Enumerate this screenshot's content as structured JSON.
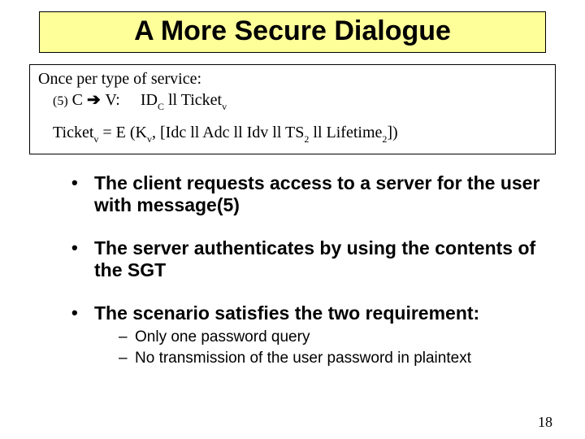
{
  "title": "A More Secure Dialogue",
  "protocol": {
    "intro": "Once per type of service:",
    "step": "(5)",
    "from": "C",
    "to": "V:",
    "payload_pre": "ID",
    "payload_sub": "C",
    "payload_post": " ll Ticket",
    "payload_sub2": "v",
    "ticket_lhs": "Ticket",
    "ticket_sub": "v",
    "ticket_eq": " = E (K",
    "ticket_k_sub": "v",
    "ticket_mid": ", [Idc ll Adc ll Idv ll TS",
    "ticket_ts_sub": "2",
    "ticket_mid2": " ll Lifetime",
    "ticket_lt_sub": "2",
    "ticket_end": "])"
  },
  "bullets": [
    "The client requests access to a server for the user with message(5)",
    "The server authenticates by using the contents of the SGT",
    "The scenario satisfies the two requirement:"
  ],
  "subbullets": [
    "Only one password query",
    "No transmission of the user password in plaintext"
  ],
  "page": "18"
}
